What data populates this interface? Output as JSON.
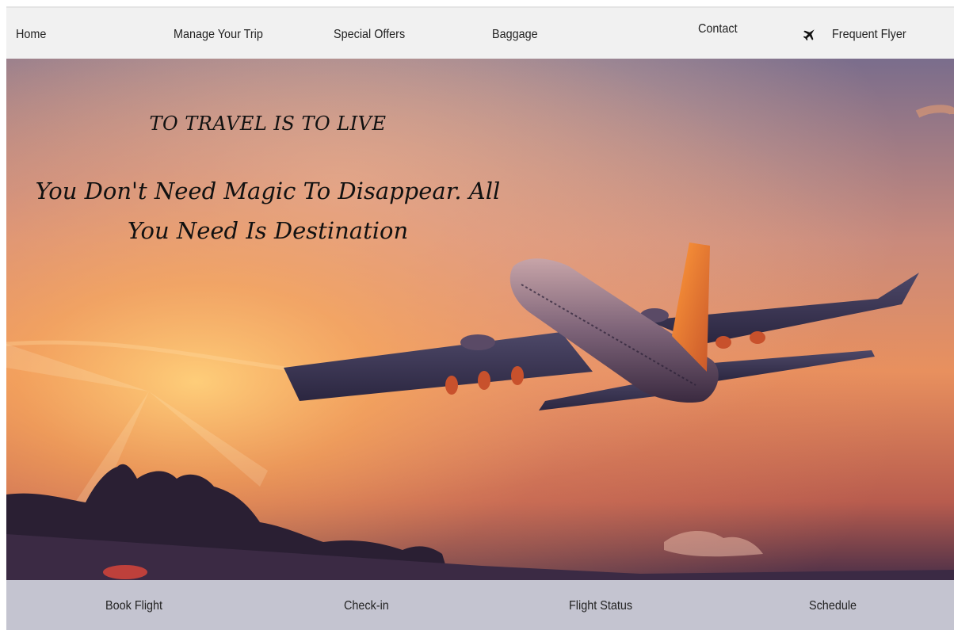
{
  "top_nav": {
    "home": "Home",
    "manage_trip": "Manage Your Trip",
    "special_offers": "Special Offers",
    "baggage": "Baggage",
    "contact": "Contact",
    "frequent_flyer_icon": "plane-icon",
    "frequent_flyer": "Frequent Flyer"
  },
  "hero": {
    "title": "TO TRAVEL IS TO LIVE",
    "tagline_line1": "You Don't Need Magic To Disappear. All",
    "tagline_line2": "You Need Is Destination",
    "image_subject": "airplane-sunset"
  },
  "bottom_nav": {
    "book_flight": "Book Flight",
    "check_in": "Check-in",
    "flight_status": "Flight Status",
    "schedule": "Schedule"
  },
  "colors": {
    "top_nav_bg": "#f1f1f1",
    "bottom_nav_bg": "#c4c4d0",
    "sky_top": "#6f6285",
    "sky_glow": "#f39a52",
    "clouds": "#2a1f33"
  }
}
